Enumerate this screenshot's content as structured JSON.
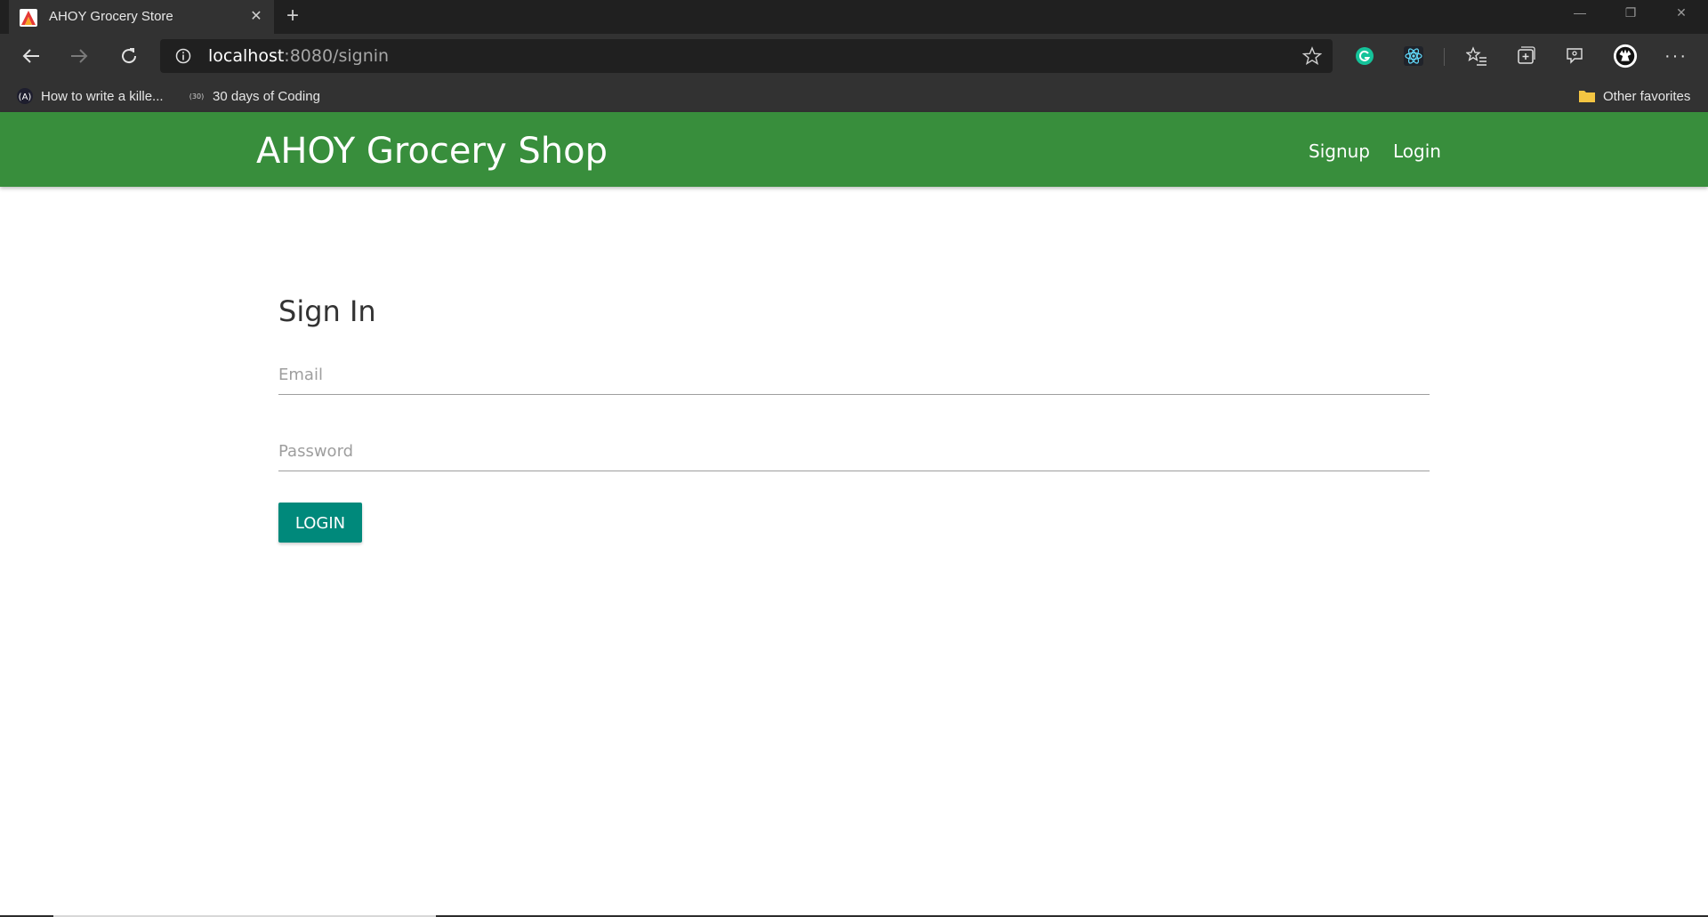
{
  "browser": {
    "tab_title": "AHOY Grocery Store",
    "new_tab_symbol": "+",
    "close_symbol": "✕",
    "url_host": "localhost",
    "url_rest": ":8080/signin",
    "bookmarks": [
      {
        "label": "How to write a kille...",
        "icon": "bookmark-site-icon"
      },
      {
        "label": "30 days of Coding",
        "icon": "bookmark-30-icon"
      }
    ],
    "other_favorites": "Other favorites",
    "window_controls": {
      "minimize": "—",
      "restore": "❐",
      "close": "✕"
    }
  },
  "app": {
    "brand": "AHOY Grocery Shop",
    "nav": {
      "signup": "Signup",
      "login": "Login"
    },
    "colors": {
      "appbar": "#388e3c",
      "button": "#00897b"
    }
  },
  "signin": {
    "title": "Sign In",
    "email_placeholder": "Email",
    "password_placeholder": "Password",
    "button_label": "LOGIN"
  }
}
